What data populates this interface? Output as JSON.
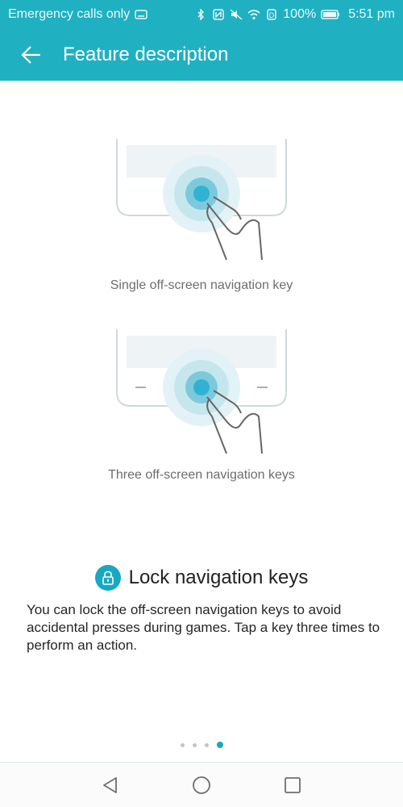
{
  "status_bar": {
    "carrier": "Emergency calls only",
    "battery": "100%",
    "time": "5:51 pm"
  },
  "app_bar": {
    "title": "Feature description"
  },
  "options": [
    {
      "caption": "Single off-screen navigation key"
    },
    {
      "caption": "Three off-screen navigation keys"
    }
  ],
  "feature": {
    "title": "Lock navigation keys",
    "description": "You can lock the off-screen navigation keys to avoid accidental presses during games. Tap a key three times to perform an action."
  },
  "pager": {
    "total": 4,
    "current": 4
  },
  "colors": {
    "accent": "#1fb1c2",
    "highlight": "#18a8c2"
  }
}
